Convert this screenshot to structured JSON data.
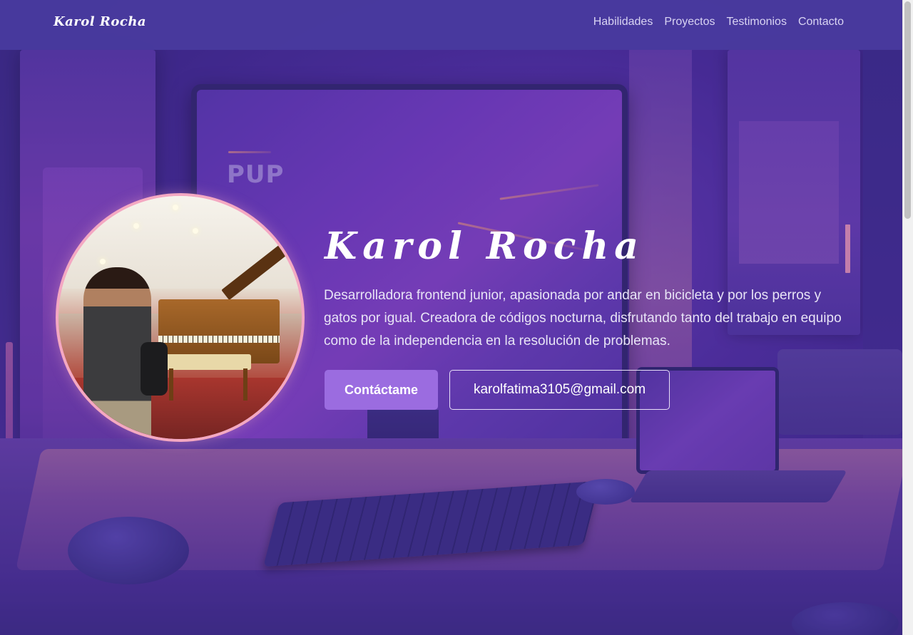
{
  "navbar": {
    "brand": "Karol Rocha",
    "links": [
      {
        "label": "Habilidades"
      },
      {
        "label": "Proyectos"
      },
      {
        "label": "Testimonios"
      },
      {
        "label": "Contacto"
      }
    ]
  },
  "hero": {
    "title": "Karol Rocha",
    "description": "Desarrolladora frontend junior, apasionada por andar en bicicleta y por los perros y gatos por igual. Creadora de códigos nocturna, disfrutando tanto del trabajo en equipo como de la independencia en la resolución de problemas.",
    "primary_button": "Contáctame",
    "email_button": "karolfatima3105@gmail.com",
    "monitor_text": "PUP"
  },
  "colors": {
    "navbar_bg": "#483a9e",
    "accent_button": "#9b6ce0",
    "photo_border": "#f4a8c2",
    "pink_marker": "#f7a0b8"
  }
}
